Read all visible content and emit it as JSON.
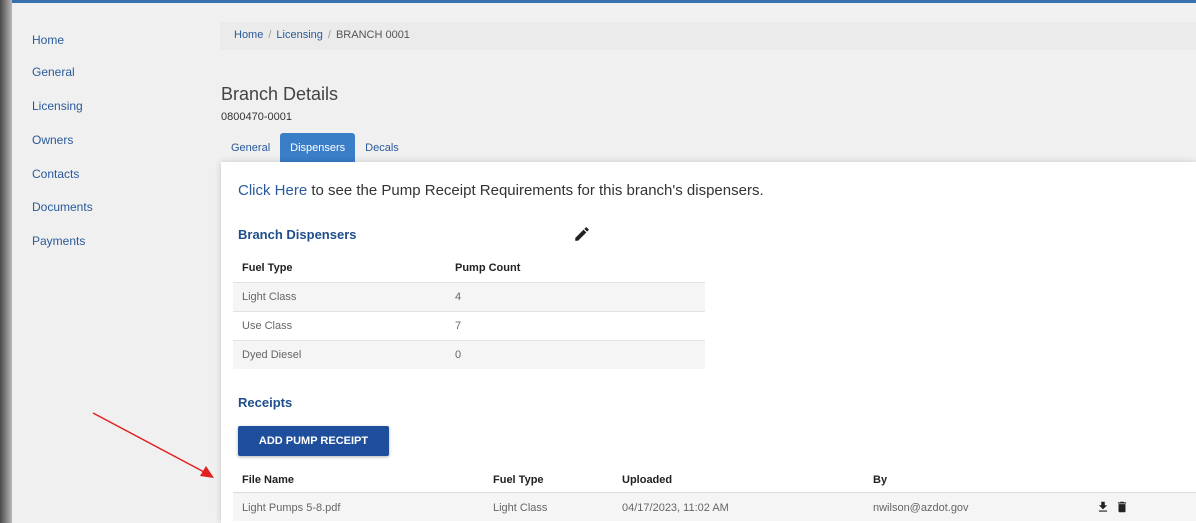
{
  "sidebar": {
    "items": [
      {
        "label": "Home"
      },
      {
        "label": "General"
      },
      {
        "label": "Licensing"
      },
      {
        "label": "Owners"
      },
      {
        "label": "Contacts"
      },
      {
        "label": "Documents"
      },
      {
        "label": "Payments"
      }
    ]
  },
  "breadcrumb": [
    "Home",
    "Licensing",
    "BRANCH 0001"
  ],
  "page": {
    "title": "Branch Details",
    "branch_id": "0800470-0001"
  },
  "tabs": [
    {
      "label": "General",
      "active": false
    },
    {
      "label": "Dispensers",
      "active": true
    },
    {
      "label": "Decals",
      "active": false
    }
  ],
  "info": {
    "link_text": "Click Here",
    "rest_text": " to see the Pump Receipt Requirements for this branch's dispensers."
  },
  "dispensers": {
    "title": "Branch Dispensers",
    "edit_icon": "pencil-icon",
    "headers": [
      "Fuel Type",
      "Pump Count"
    ],
    "rows": [
      [
        "Light Class",
        "4"
      ],
      [
        "Use Class",
        "7"
      ],
      [
        "Dyed Diesel",
        "0"
      ]
    ]
  },
  "receipts": {
    "title": "Receipts",
    "add_button": "ADD PUMP RECEIPT",
    "headers": [
      "File Name",
      "Fuel Type",
      "Uploaded",
      "By"
    ],
    "rows": [
      {
        "file": "Light Pumps 5-8.pdf",
        "fuel": "Light Class",
        "uploaded": "04/17/2023, 11:02 AM",
        "by": "nwilson@azdot.gov",
        "actions": [
          "download-icon",
          "trash-icon"
        ]
      }
    ]
  },
  "colors": {
    "accent": "#1f4e9c",
    "link": "#2a5a9a",
    "active_tab": "#3a7ec8",
    "annotation_arrow": "#e02020"
  }
}
